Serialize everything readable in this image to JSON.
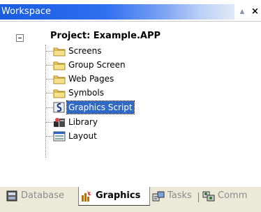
{
  "titlebar": {
    "title": "Workspace",
    "up_icon": "▲",
    "close_icon": "×"
  },
  "tree": {
    "root": "Project: Example.APP",
    "items": [
      {
        "label": "Screens",
        "icon": "folder-icon"
      },
      {
        "label": "Group Screen",
        "icon": "folder-icon"
      },
      {
        "label": "Web Pages",
        "icon": "folder-icon"
      },
      {
        "label": "Symbols",
        "icon": "folder-icon"
      },
      {
        "label": "Graphics Script",
        "icon": "script-icon",
        "selected": true
      },
      {
        "label": "Library",
        "icon": "library-icon"
      },
      {
        "label": "Layout",
        "icon": "layout-icon"
      }
    ]
  },
  "tabs": [
    {
      "label": "Database",
      "icon": "database-icon"
    },
    {
      "label": "Graphics",
      "icon": "graphics-icon",
      "active": true
    },
    {
      "label": "Tasks",
      "icon": "tasks-icon"
    },
    {
      "label": "Comm",
      "icon": "comm-icon"
    }
  ],
  "colors": {
    "titlebar_start": "#1a5ce0",
    "selection": "#316ac5",
    "folder": "#f3d56b",
    "tab_bar": "#ece9d8"
  }
}
